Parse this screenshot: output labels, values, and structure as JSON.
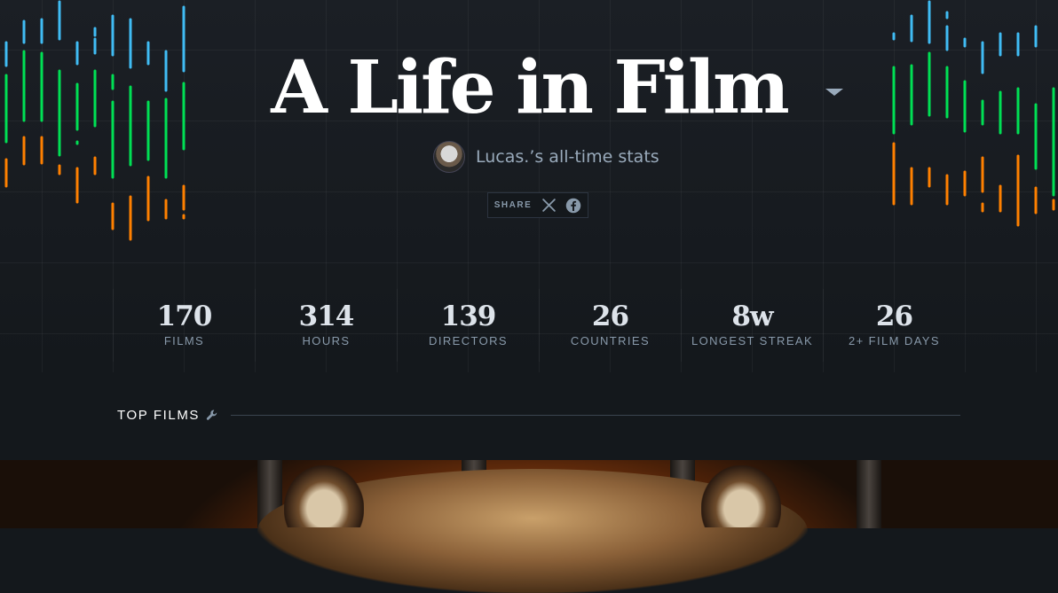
{
  "hero": {
    "title": "A Life in Film",
    "user_stats_label": "Lucas.’s all-time stats",
    "share_label": "SHARE",
    "share_icons": [
      "x-icon",
      "facebook-icon"
    ],
    "bar_colors": {
      "blue": "#40bcf4",
      "green": "#00e054",
      "orange": "#ff8000"
    }
  },
  "stats": [
    {
      "value": "170",
      "label": "FILMS"
    },
    {
      "value": "314",
      "label": "HOURS"
    },
    {
      "value": "139",
      "label": "DIRECTORS"
    },
    {
      "value": "26",
      "label": "COUNTRIES"
    },
    {
      "value": "8w",
      "label": "LONGEST STREAK"
    },
    {
      "value": "26",
      "label": "2+ FILM DAYS"
    }
  ],
  "top_films": {
    "title": "TOP FILMS",
    "icon": "wrench-icon"
  }
}
